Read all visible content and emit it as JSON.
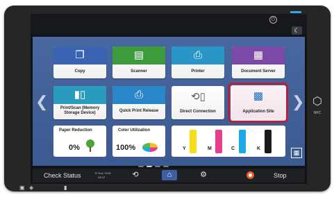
{
  "device": {
    "power_icon": "power-icon",
    "energy_saver_icon": "moon-icon",
    "nfc_icon": "nfc-icon",
    "nfc_label": "NFC"
  },
  "apps": [
    {
      "name": "copy",
      "label": "Copy",
      "icon": "copy-icon",
      "color": "#3a63b4"
    },
    {
      "name": "scanner",
      "label": "Scanner",
      "icon": "scanner-icon",
      "color": "#3d9b3d"
    },
    {
      "name": "printer",
      "label": "Printer",
      "icon": "printer-icon",
      "color": "#2a96c8"
    },
    {
      "name": "document-server",
      "label": "Document Server",
      "icon": "document-server-icon",
      "color": "#7a4aa6"
    },
    {
      "name": "print-scan-memory",
      "label": "Print/Scan (Memory Storage Device)",
      "icon": "memory-storage-icon",
      "color": "#2a9bbd"
    },
    {
      "name": "quick-print-release",
      "label": "Quick Print Release",
      "icon": "quick-print-icon",
      "color": "#2a86c8"
    },
    {
      "name": "direct-connection",
      "label": "Direct Connection",
      "icon": "direct-connection-icon",
      "color": "#555555"
    },
    {
      "name": "application-site",
      "label": "Application Site",
      "icon": "application-site-icon",
      "color": "#1f6fc0"
    }
  ],
  "paper_reduction": {
    "label": "Paper Reduction",
    "value": "0%",
    "icon": "tree-icon"
  },
  "color_utilization": {
    "label": "Color Utilization",
    "value": "100%",
    "icon": "color-pie-icon"
  },
  "toner": [
    {
      "label": "Y",
      "color": "#f5dd1a"
    },
    {
      "label": "M",
      "color": "#e63c8c"
    },
    {
      "label": "C",
      "color": "#1ea8e6"
    },
    {
      "label": "K",
      "color": "#1a1a1a"
    }
  ],
  "taskbar": {
    "check_status": "Check Status",
    "date": "12 Nov, 2018",
    "time": "08:15",
    "back_icon": "back-icon",
    "home_icon": "home-icon",
    "settings_icon": "gear-icon",
    "stop_icon": "stop-icon",
    "stop": "Stop"
  },
  "page_indicator": {
    "count": 4,
    "active": 2
  }
}
